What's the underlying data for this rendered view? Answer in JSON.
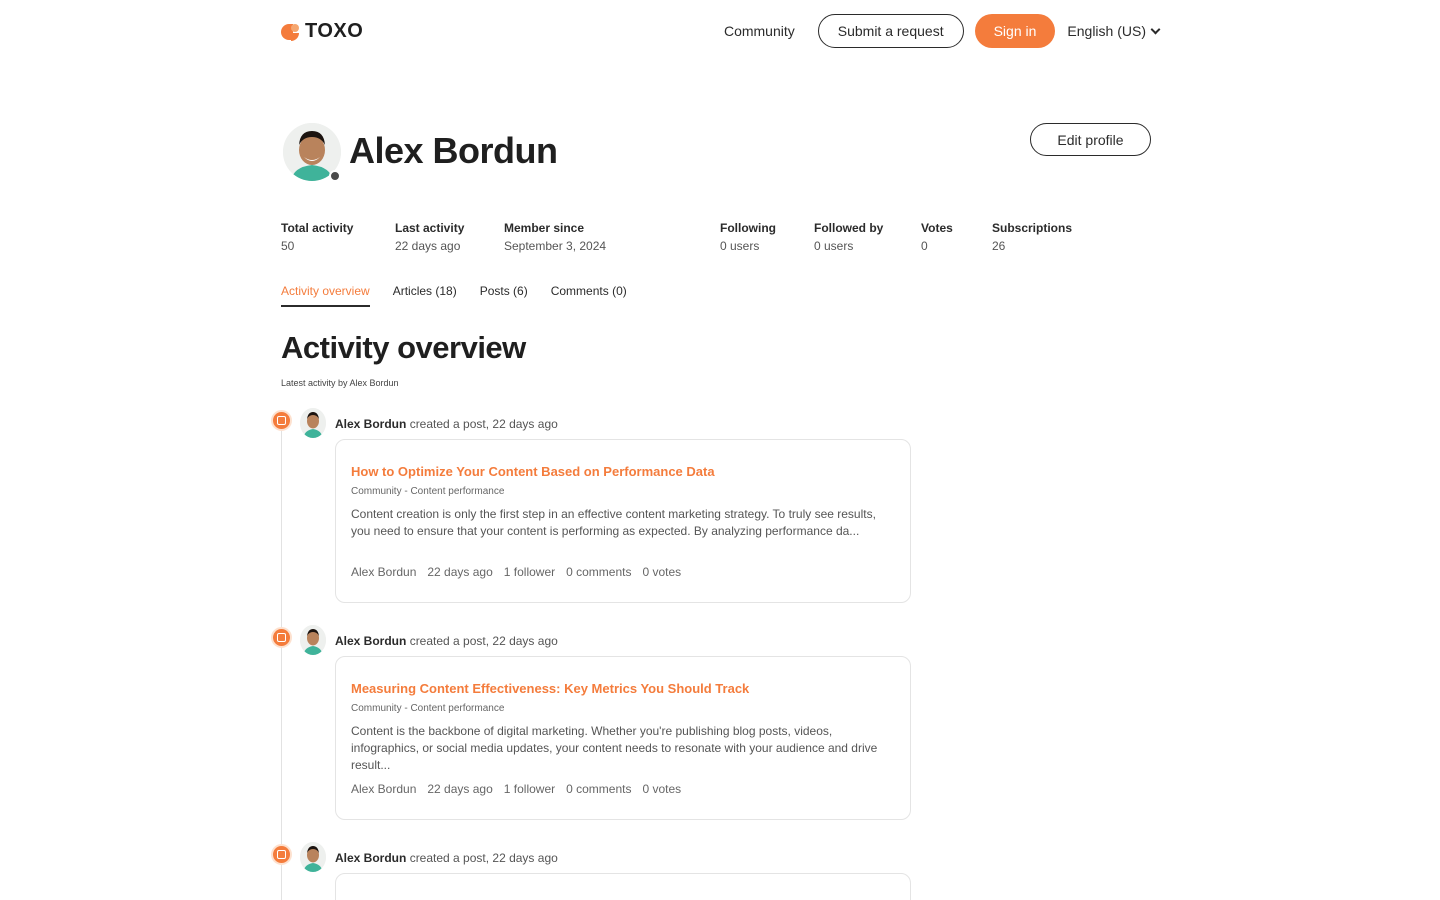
{
  "header": {
    "logo_text": "TOXO",
    "nav": {
      "community": "Community",
      "submit_request": "Submit a request",
      "sign_in": "Sign in",
      "language": "English (US)"
    }
  },
  "profile": {
    "name": "Alex Bordun",
    "edit_label": "Edit profile",
    "stats": [
      {
        "label": "Total activity",
        "value": "50"
      },
      {
        "label": "Last activity",
        "value": "22 days ago"
      },
      {
        "label": "Member since",
        "value": "September 3, 2024"
      },
      {
        "label": "Following",
        "value": "0 users"
      },
      {
        "label": "Followed by",
        "value": "0 users"
      },
      {
        "label": "Votes",
        "value": "0"
      },
      {
        "label": "Subscriptions",
        "value": "26"
      }
    ]
  },
  "tabs": [
    {
      "label": "Activity overview"
    },
    {
      "label": "Articles (18)"
    },
    {
      "label": "Posts (6)"
    },
    {
      "label": "Comments (0)"
    }
  ],
  "activity": {
    "title": "Activity overview",
    "subtitle": "Latest activity by Alex Bordun",
    "items": [
      {
        "author": "Alex Bordun",
        "action": "created a post, 22 days ago",
        "title": "How to Optimize Your Content Based on Performance Data",
        "category": "Community - Content performance",
        "excerpt": "Content creation is only the first step in an effective content marketing strategy. To truly see results, you need to ensure that your content is performing as expected. By analyzing performance da...",
        "meta_author": "Alex Bordun",
        "meta_time": "22 days ago",
        "meta_followers": "1 follower",
        "meta_comments": "0 comments",
        "meta_votes": "0 votes"
      },
      {
        "author": "Alex Bordun",
        "action": "created a post, 22 days ago",
        "title": "Measuring Content Effectiveness: Key Metrics You Should Track",
        "category": "Community - Content performance",
        "excerpt": "Content is the backbone of digital marketing. Whether you're publishing blog posts, videos, infographics, or social media updates, your content needs to resonate with your audience and drive result...",
        "meta_author": "Alex Bordun",
        "meta_time": "22 days ago",
        "meta_followers": "1 follower",
        "meta_comments": "0 comments",
        "meta_votes": "0 votes"
      },
      {
        "author": "Alex Bordun",
        "action": "created a post, 22 days ago"
      }
    ]
  },
  "colors": {
    "accent": "#f47c3c",
    "text": "#2b2b2b",
    "border": "#e4e4e4"
  }
}
